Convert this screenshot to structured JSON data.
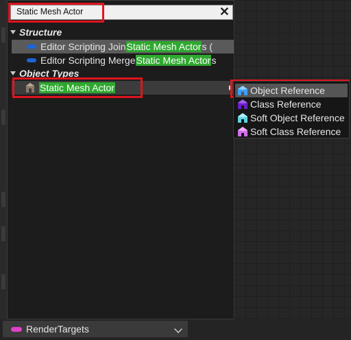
{
  "search": {
    "value": "Static Mesh Actor",
    "clear_icon": "close-icon"
  },
  "menu": {
    "categories": [
      {
        "label": "Structure"
      },
      {
        "label": "Object Types"
      }
    ],
    "structure_items": [
      {
        "prefix": "Editor Scripting Join ",
        "highlight": "Static Mesh Actor",
        "suffix": "s (",
        "icon": "function-pill-icon"
      },
      {
        "prefix": "Editor Scripting Merge ",
        "highlight": "Static Mesh Actor",
        "suffix": "s",
        "icon": "function-pill-icon"
      }
    ],
    "object_type_item": {
      "highlight": "Static Mesh Actor",
      "icon": "static-mesh-actor-icon"
    }
  },
  "submenu": {
    "items": [
      {
        "label": "Object Reference",
        "icon": "object-reference-icon",
        "color": "#3aa0ff"
      },
      {
        "label": "Class Reference",
        "icon": "class-reference-icon",
        "color": "#7a2ad8"
      },
      {
        "label": "Soft Object Reference",
        "icon": "soft-object-reference-icon",
        "color": "#5fd2e0"
      },
      {
        "label": "Soft Class Reference",
        "icon": "soft-class-reference-icon",
        "color": "#d070e8"
      }
    ]
  },
  "footer": {
    "render_targets_label": "RenderTargets",
    "pill_color": "#e040c8"
  },
  "colors": {
    "highlight": "#2fa82f",
    "annotation": "#e0141e",
    "function_pill": "#1e64d8"
  }
}
